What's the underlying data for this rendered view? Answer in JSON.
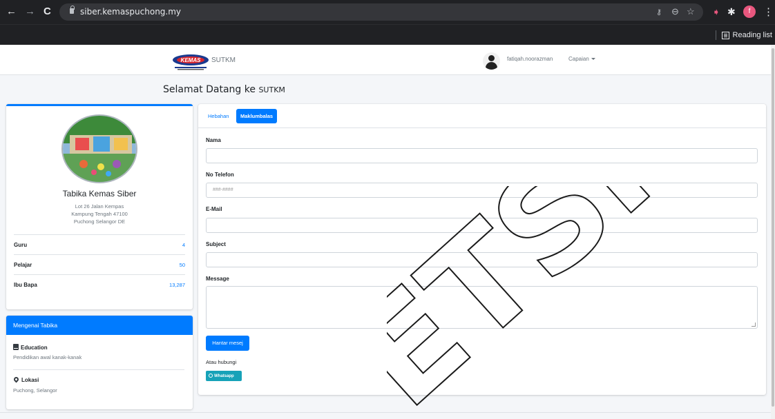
{
  "browser": {
    "url": "siber.kemaspuchong.my",
    "reading_list": "Reading list",
    "profile_initial": "f",
    "icons": [
      "back-arrow-icon",
      "forward-arrow-icon",
      "reload-icon",
      "lock-icon",
      "key-icon",
      "zoom-icon",
      "star-icon",
      "extension-icon",
      "puzzle-icon",
      "kebab-menu-icon"
    ]
  },
  "nav": {
    "brand": "SUTKM",
    "logo_text": "KEMAS",
    "username": "fatiqah.noorazman",
    "menu": "Capaian"
  },
  "welcome": {
    "prefix": "Selamat Datang ke",
    "suffix": "SUTKM"
  },
  "profile": {
    "name": "Tabika Kemas Siber",
    "address": [
      "Lot 26 Jalan Kempas",
      "Kampung Tengah 47100",
      "Puchong Selangor DE"
    ],
    "stats": [
      {
        "label": "Guru",
        "value": "4"
      },
      {
        "label": "Pelajar",
        "value": "50"
      },
      {
        "label": "Ibu Bapa",
        "value": "13,287"
      }
    ]
  },
  "about": {
    "title": "Mengenai Tabika",
    "items": [
      {
        "icon": "book-icon",
        "title": "Education",
        "text": "Pendidikan awal kanak-kanak"
      },
      {
        "icon": "map-pin-icon",
        "title": "Lokasi",
        "text": "Puchong, Selangor"
      }
    ]
  },
  "tabs": [
    "Hebahan",
    "Maklumbalas"
  ],
  "active_tab": "Maklumbalas",
  "form": {
    "fields": [
      {
        "label": "Nama",
        "value": "",
        "placeholder": ""
      },
      {
        "label": "No Telefon",
        "value": "",
        "placeholder": "###-####"
      },
      {
        "label": "E-Mail",
        "value": "",
        "placeholder": ""
      },
      {
        "label": "Subject",
        "value": "",
        "placeholder": ""
      },
      {
        "label": "Message",
        "value": "",
        "placeholder": ""
      }
    ],
    "submit": "Hantar mesej",
    "alt_contact": "Atau hubungi",
    "whatsapp": "Whatsapp"
  },
  "watermark": "ETSM",
  "colors": {
    "primary": "#007bff",
    "info": "#17a2b8",
    "chrome_dark": "#202124",
    "page_bg": "#f4f6f9"
  }
}
